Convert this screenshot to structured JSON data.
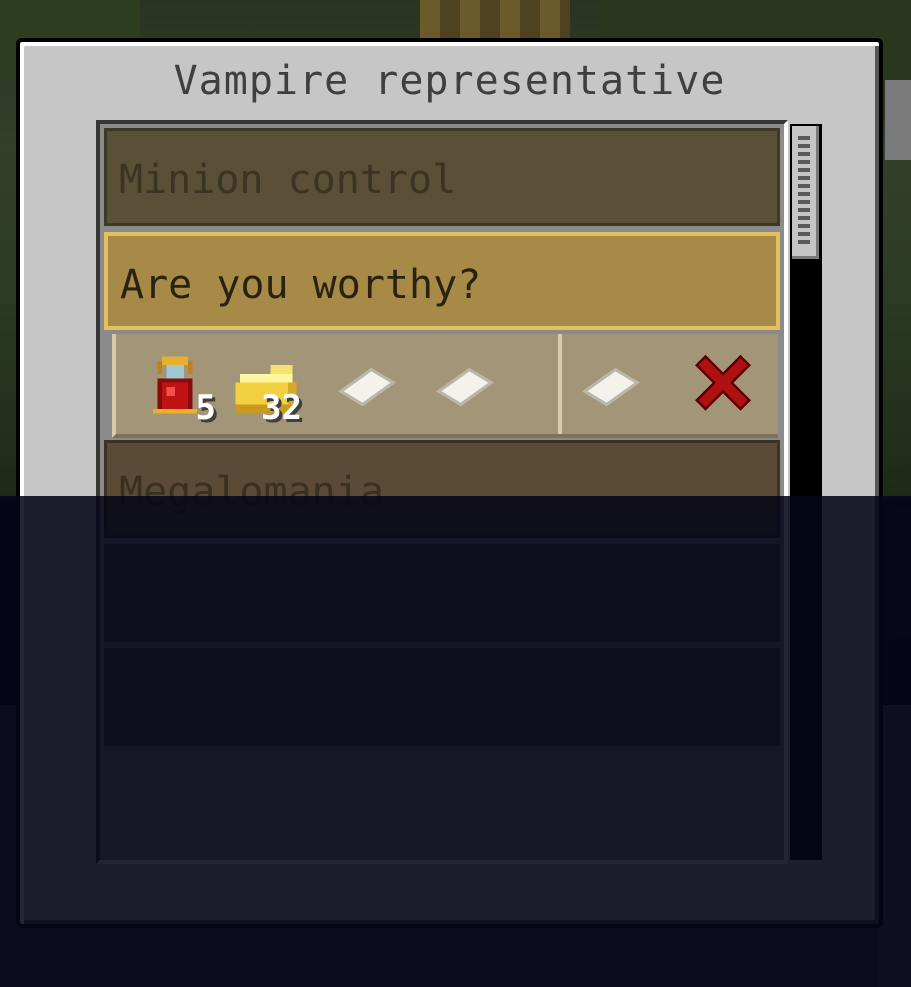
{
  "window": {
    "title": "Vampire representative"
  },
  "tasks": [
    {
      "label": "Minion control",
      "state": "normal"
    },
    {
      "label": "Are you worthy?",
      "state": "selected"
    },
    {
      "label": "Megalomania",
      "state": "normal"
    }
  ],
  "trade": {
    "requirements": [
      {
        "item": "vampire-blood-bottle-icon",
        "count": "5"
      },
      {
        "item": "gold-ingot-icon",
        "count": "32"
      },
      {
        "item": "paper-icon",
        "count": ""
      },
      {
        "item": "paper-icon",
        "count": ""
      }
    ],
    "rewards": [
      {
        "item": "paper-icon",
        "count": ""
      }
    ],
    "cancel_icon": "close-x-icon"
  },
  "colors": {
    "selected_border": "#e3c060",
    "cancel_red": "#b01010"
  }
}
